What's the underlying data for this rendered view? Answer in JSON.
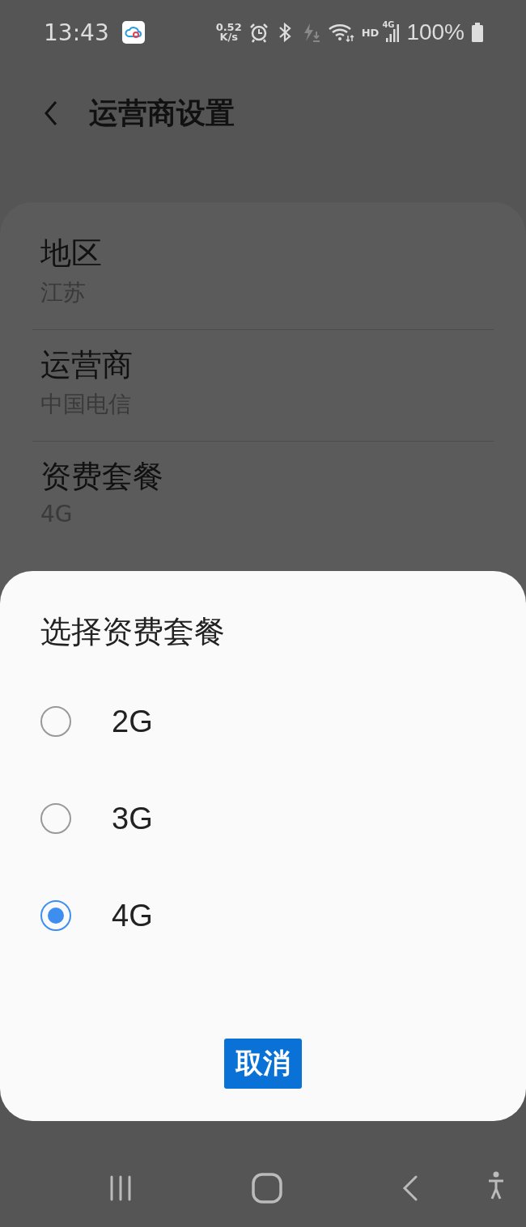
{
  "status_bar": {
    "time": "13:43",
    "net_speed": "0.52",
    "net_unit": "K/s",
    "hd": "HD",
    "network": "4G",
    "battery": "100%"
  },
  "header": {
    "title": "运营商设置"
  },
  "settings": [
    {
      "title": "地区",
      "value": "江苏"
    },
    {
      "title": "运营商",
      "value": "中国电信"
    },
    {
      "title": "资费套餐",
      "value": "4G"
    }
  ],
  "dialog": {
    "title": "选择资费套餐",
    "options": [
      {
        "label": "2G",
        "selected": false
      },
      {
        "label": "3G",
        "selected": false
      },
      {
        "label": "4G",
        "selected": true
      }
    ],
    "cancel": "取消"
  }
}
